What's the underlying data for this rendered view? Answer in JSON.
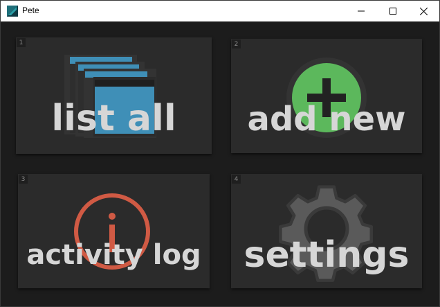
{
  "window": {
    "title": "Pete"
  },
  "tiles": [
    {
      "number": "1",
      "label": "list all",
      "icon": "windows-stack-icon"
    },
    {
      "number": "2",
      "label": "add new",
      "icon": "plus-circle-icon"
    },
    {
      "number": "3",
      "label": "activity log",
      "icon": "info-circle-icon"
    },
    {
      "number": "4",
      "label": "settings",
      "icon": "gear-icon"
    }
  ],
  "colors": {
    "tile_background": "#2b2b2b",
    "label": "#d6d6d6",
    "list_icon_blue": "#3f8fb7",
    "add_icon_green": "#5cb85c",
    "info_icon_red": "#d05a44",
    "gear_gray": "#5a5a5a"
  }
}
